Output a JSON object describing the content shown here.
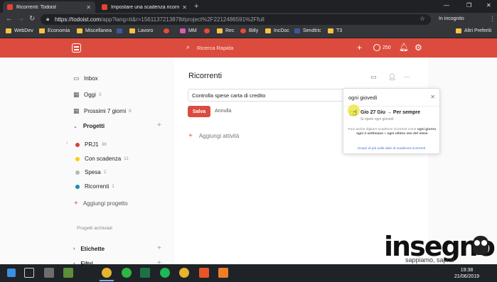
{
  "browser": {
    "tabs": [
      {
        "title": "Ricorrenti: Todoist",
        "active": true
      },
      {
        "title": "Impostare una scadenza ricorre",
        "active": false
      }
    ],
    "url_host": "https://todoist.com",
    "url_path": "/app?lang=it&r=1561137213878#project%2F2212486591%2Ffull",
    "incognito_label": "In incognito",
    "bookmarks": [
      "WebDev",
      "Economia",
      "Miscellanea",
      "Lavoro",
      "MM",
      "Rec",
      "Bitly",
      "IncDoc",
      "Sendtric",
      "T3"
    ],
    "other_bookmarks": "Altri Preferiti"
  },
  "header": {
    "search_placeholder": "Ricerca Rapida",
    "karma": "250"
  },
  "sidebar": {
    "inbox": "Inbox",
    "today": {
      "label": "Oggi",
      "count": "3"
    },
    "next7": {
      "label": "Prossimi 7 giorni",
      "count": "8"
    },
    "projects_heading": "Progetti",
    "projects": [
      {
        "name": "PRJ1",
        "count": "38",
        "color": "#db4035"
      },
      {
        "name": "Con scadenza",
        "count": "11",
        "color": "#fad000"
      },
      {
        "name": "Spesa",
        "count": "2",
        "color": "#b8b8b8"
      },
      {
        "name": "Ricorrenti",
        "count": "1",
        "color": "#158fad"
      }
    ],
    "add_project": "Aggiungi progetto",
    "archived": "Progetti archiviati",
    "labels_heading": "Etichette",
    "filters_heading": "Filtri"
  },
  "main": {
    "title": "Ricorrenti",
    "task_value": "Controlla spese carta di credito",
    "save_label": "Salva",
    "cancel_label": "Annulla",
    "add_task_label": "Aggiungi attività"
  },
  "schedule_popup": {
    "due_value": "ogni giovedì",
    "option_label": "Gio 27 Giu → Per sempre",
    "option_sub": "Si ripete ogni giovedì",
    "hint_plain_1": "Puoi anche digitare scadenze ricorrenti come",
    "hint_bold_1": "ogni giorno",
    "hint_plain_2": ",",
    "hint_bold_2": "ogni 2 settimane",
    "hint_plain_3": "e",
    "hint_bold_3": "ogni ultimo ven del mese",
    "hint_plain_4": ".",
    "link": "Scopri di più sulle date di scadenza ricorrenti"
  },
  "brand": {
    "word": "insegno",
    "tagline": "sappiamo, sapral"
  },
  "taskbar": {
    "time": "19:38",
    "date": "21/06/2019"
  }
}
